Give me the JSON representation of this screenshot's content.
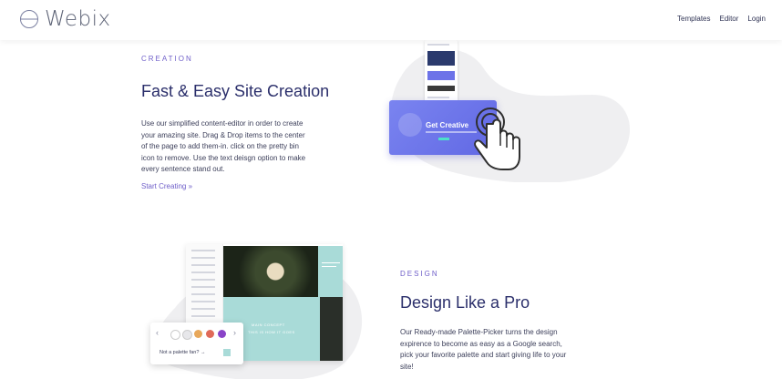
{
  "header": {
    "brand": "Webix",
    "nav": [
      "Templates",
      "Editor",
      "Login"
    ]
  },
  "section_creation": {
    "eyebrow": "CREATION",
    "title": "Fast & Easy Site Creation",
    "lines": [
      "Use our simplified content-editor in order to create",
      "your amazing site. Drag & Drop items to the center",
      "of the page to add them-in. click on the pretty bin",
      "icon to remove. Use the text deisgn option to make",
      "every sentence stand out."
    ],
    "link": "Start Creating »",
    "card_label": "Get Creative"
  },
  "section_design": {
    "eyebrow": "DESIGN",
    "title": "Design Like a Pro",
    "lines": [
      "Our Ready-made Palette-Picker turns the design",
      "expirence to become as easy as a Google search,",
      "pick your favorite palette and start giving life to your",
      "site!"
    ],
    "caption_top": "MAIN CONCEPT",
    "caption_bottom": "THIS IS HOW IT GOES",
    "palette_question": "Not a palette fan? →",
    "palette_colors": [
      "#ffffff",
      "#e7e7ea",
      "#e8a85b",
      "#e06a59",
      "#8a44c8"
    ]
  }
}
